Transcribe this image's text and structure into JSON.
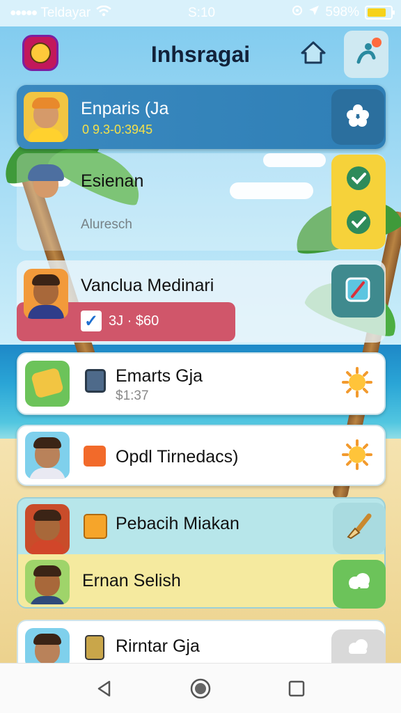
{
  "status_bar": {
    "signal": "●●●●●",
    "carrier": "Teldayar",
    "time": "S:10",
    "battery_percent": "598%",
    "icons": [
      "wifi-icon",
      "alarm-icon",
      "location-icon",
      "battery-icon"
    ]
  },
  "header": {
    "title": "Inhsragai",
    "icons": [
      "app-logo-icon",
      "home-icon",
      "profile-icon"
    ]
  },
  "contacts": [
    {
      "name": "Enparis (Ja",
      "detail": "0 9.3-0:3945",
      "action_icon": "star-icon"
    },
    {
      "name": "Esienan",
      "detail": "Aluresch",
      "action_icon": "check-icon"
    },
    {
      "name": "Vanclua Medinari",
      "detail": "3J · $60",
      "action_icon": "compass-icon"
    },
    {
      "name": "Emarts Gja",
      "detail": "$1:37",
      "action_icon": "sun-icon"
    },
    {
      "name": "Opdl Tirnedacs)",
      "detail": "",
      "action_icon": "sun-icon"
    },
    {
      "name": "Pebacih Miakan",
      "detail": "",
      "action_icon": "brush-icon"
    },
    {
      "name": "Ernan Selish",
      "detail": "",
      "action_icon": "cloud-icon"
    },
    {
      "name": "Rirntar Gja",
      "detail": "",
      "action_icon": "cloud-icon"
    }
  ],
  "navbar": {
    "icons": [
      "back-icon",
      "home-circle-icon",
      "recents-icon"
    ]
  },
  "colors": {
    "accent_blue": "#2f7fb6",
    "accent_yellow": "#f6d23a",
    "accent_red": "#d0566a",
    "accent_green": "#6cc35a"
  }
}
